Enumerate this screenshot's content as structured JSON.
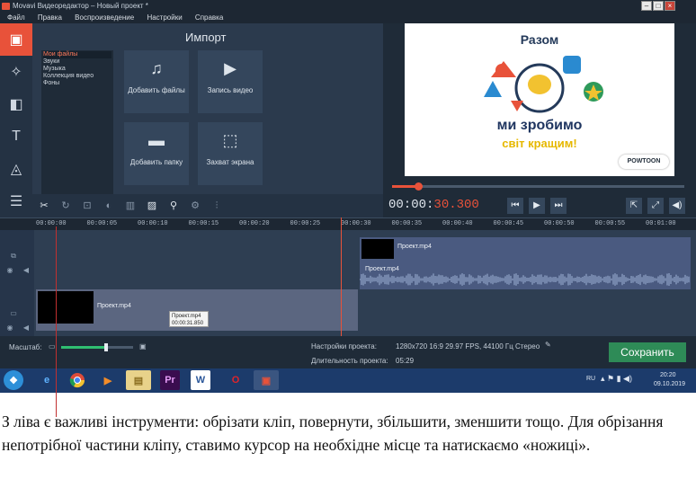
{
  "window": {
    "title": "Movavi Видеоредактор – Новый проект *"
  },
  "menu": [
    "Файл",
    "Правка",
    "Воспроизведение",
    "Настройки",
    "Справка"
  ],
  "import": {
    "title": "Импорт",
    "files": [
      "Мои файлы",
      "Звуки",
      "Музыка",
      "Коллекция видео",
      "Фоны"
    ],
    "tiles": {
      "add_files": "Добавить файлы",
      "record_video": "Запись видео",
      "add_folder": "Добавить папку",
      "screen_capture": "Захват экрана"
    }
  },
  "preview": {
    "line1": "Разом",
    "line2": "ми зробимо",
    "line3": "світ кращим!",
    "brand": "POWTOON",
    "progress": 0.09
  },
  "player": {
    "time_main": "00:00:",
    "time_ms": "30.300"
  },
  "ruler": [
    "00:00:00",
    "00:00:05",
    "00:00:10",
    "00:00:15",
    "00:00:20",
    "00:00:25",
    "00:00:30",
    "00:00:35",
    "00:00:40",
    "00:00:45",
    "00:00:50",
    "00:00:55",
    "00:01:00"
  ],
  "timeline": {
    "top_clip": "Проект.mp4",
    "top_audio": "Проект.mp4",
    "main_clip": "Проект.mp4",
    "tooltip_name": "Проект.mp4",
    "tooltip_time": "00:00:31.850"
  },
  "bottom": {
    "zoom_label": "Масштаб:",
    "settings_label": "Настройки проекта:",
    "settings_value": "1280x720 16:9 29.97 FPS, 44100 Гц Стерео",
    "duration_label": "Длительность проекта:",
    "duration_value": "05:29",
    "save": "Сохранить"
  },
  "taskbar": {
    "lang": "RU",
    "time": "20:20",
    "date": "09.10.2019"
  },
  "caption": "З ліва є важливі інструменти: обрізати кліп, повернути, збільшити, зменшити тощо. Для обрізання непотрібної частини кліпу, ставимо курсор на необхідне місце та натискаємо «ножиці»."
}
